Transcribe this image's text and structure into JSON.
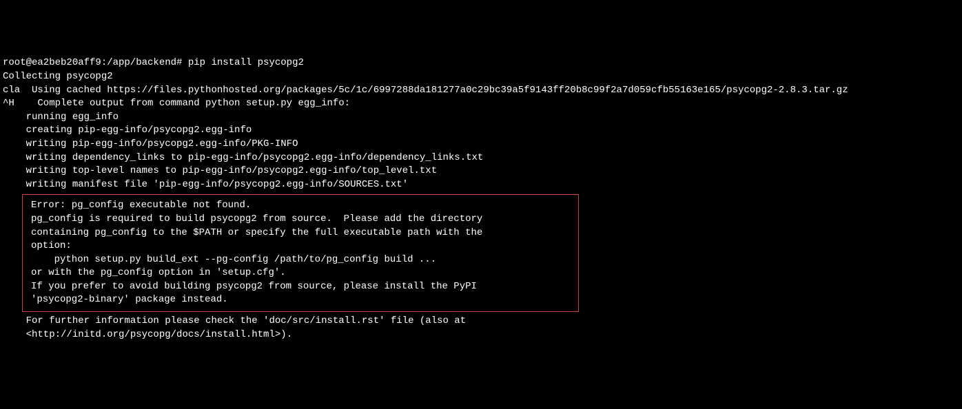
{
  "terminal": {
    "line1": "root@ea2beb20aff9:/app/backend# pip install psycopg2",
    "line2": "Collecting psycopg2",
    "line3": "cla  Using cached https://files.pythonhosted.org/packages/5c/1c/6997288da181277a0c29bc39a5f9143ff20b8c99f2a7d059cfb55163e165/psycopg2-2.8.3.tar.gz",
    "line4": "^H    Complete output from command python setup.py egg_info:",
    "line5": "    running egg_info",
    "line6": "    creating pip-egg-info/psycopg2.egg-info",
    "line7": "    writing pip-egg-info/psycopg2.egg-info/PKG-INFO",
    "line8": "    writing dependency_links to pip-egg-info/psycopg2.egg-info/dependency_links.txt",
    "line9": "    writing top-level names to pip-egg-info/psycopg2.egg-info/top_level.txt",
    "line10": "    writing manifest file 'pip-egg-info/psycopg2.egg-info/SOURCES.txt'",
    "error": {
      "l1": "Error: pg_config executable not found.",
      "l2": "",
      "l3": "pg_config is required to build psycopg2 from source.  Please add the directory",
      "l4": "containing pg_config to the $PATH or specify the full executable path with the",
      "l5": "option:",
      "l6": "",
      "l7": "    python setup.py build_ext --pg-config /path/to/pg_config build ...",
      "l8": "",
      "l9": "or with the pg_config option in 'setup.cfg'.",
      "l10": "",
      "l11": "If you prefer to avoid building psycopg2 from source, please install the PyPI",
      "l12": "'psycopg2-binary' package instead."
    },
    "line11": "",
    "line12": "    For further information please check the 'doc/src/install.rst' file (also at",
    "line13": "    <http://initd.org/psycopg/docs/install.html>)."
  }
}
